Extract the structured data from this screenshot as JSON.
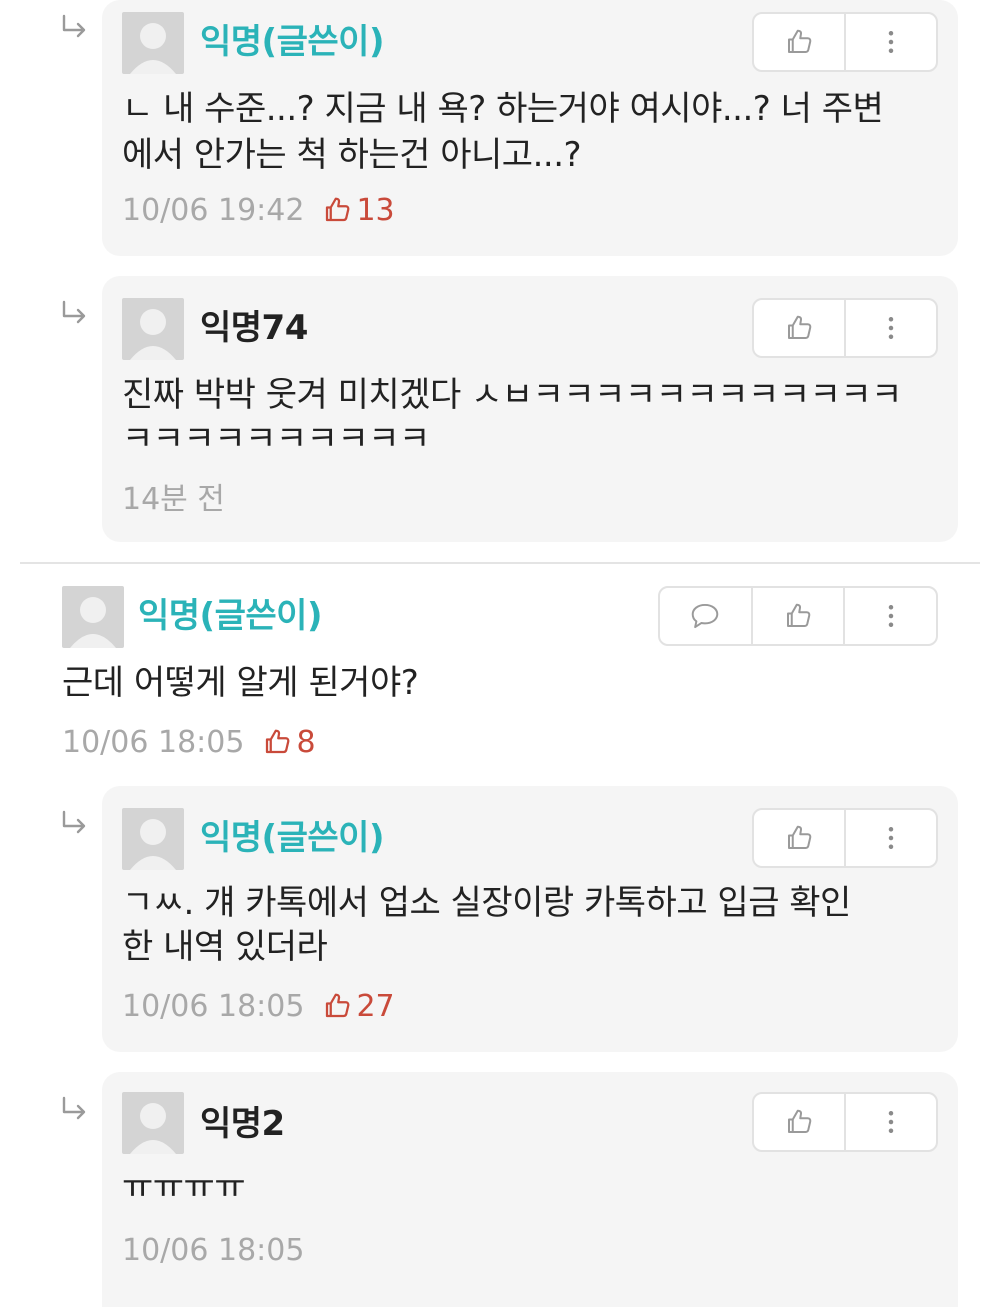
{
  "colors": {
    "op_name": "#2bb3b8",
    "anon_name": "#222222",
    "timestamp": "#a8a8a8",
    "likes": "#c94a3a",
    "reply_bg": "#f5f5f5"
  },
  "comments": [
    {
      "author": "익명(글쓴이)",
      "line1": "ㄴ 내 수준...? 지금 내 욕? 하는거야 여시야...? 너 주변",
      "line2": "에서 안가는 척 하는건 아니고...?",
      "time": "10/06 19:42",
      "likes": "13"
    },
    {
      "author": "익명74",
      "line1": "진짜 박박 웃겨 미치겠다 ㅅㅂㅋㅋㅋㅋㅋㅋㅋㅋㅋㅋㅋㅋ",
      "line2": "ㅋㅋㅋㅋㅋㅋㅋㅋㅋㅋ",
      "time": "14분 전"
    },
    {
      "author": "익명(글쓴이)",
      "line1": "근데 어떻게 알게 된거야?",
      "time": "10/06 18:05",
      "likes": "8"
    },
    {
      "author": "익명(글쓴이)",
      "line1": "ㄱㅆ. 걔 카톡에서 업소 실장이랑 카톡하고 입금 확인",
      "line2": "한 내역 있더라",
      "time": "10/06 18:05",
      "likes": "27"
    },
    {
      "author": "익명2",
      "line1": "ㅠㅠㅠㅠ",
      "time": "10/06 18:05"
    }
  ],
  "icons": [
    "reply-arrow-icon",
    "avatar-icon",
    "thumbs-up-icon",
    "more-vertical-icon",
    "speech-bubble-icon"
  ]
}
